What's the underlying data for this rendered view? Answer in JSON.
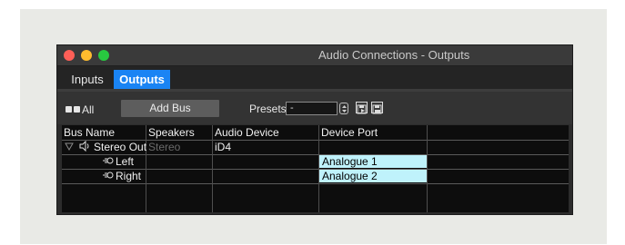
{
  "window": {
    "title": "Audio Connections - Outputs"
  },
  "tabs": [
    {
      "label": "Inputs",
      "active": false
    },
    {
      "label": "Outputs",
      "active": true
    }
  ],
  "toolbar": {
    "all_label": "All",
    "add_bus_label": "Add Bus",
    "presets_label": "Presets",
    "preset_value": "-"
  },
  "table": {
    "columns": [
      "Bus Name",
      "Speakers",
      "Audio Device",
      "Device Port"
    ],
    "bus": {
      "name": "Stereo Out",
      "speakers": "Stereo",
      "device": "iD4"
    },
    "channels": [
      {
        "name": "Left",
        "port": "Analogue 1"
      },
      {
        "name": "Right",
        "port": "Analogue 2"
      }
    ]
  },
  "colors": {
    "active_tab": "#1a84f4",
    "port_highlight": "#bff2fb",
    "close": "#fe5f57",
    "minimize": "#febc2e",
    "zoom": "#28c840"
  }
}
